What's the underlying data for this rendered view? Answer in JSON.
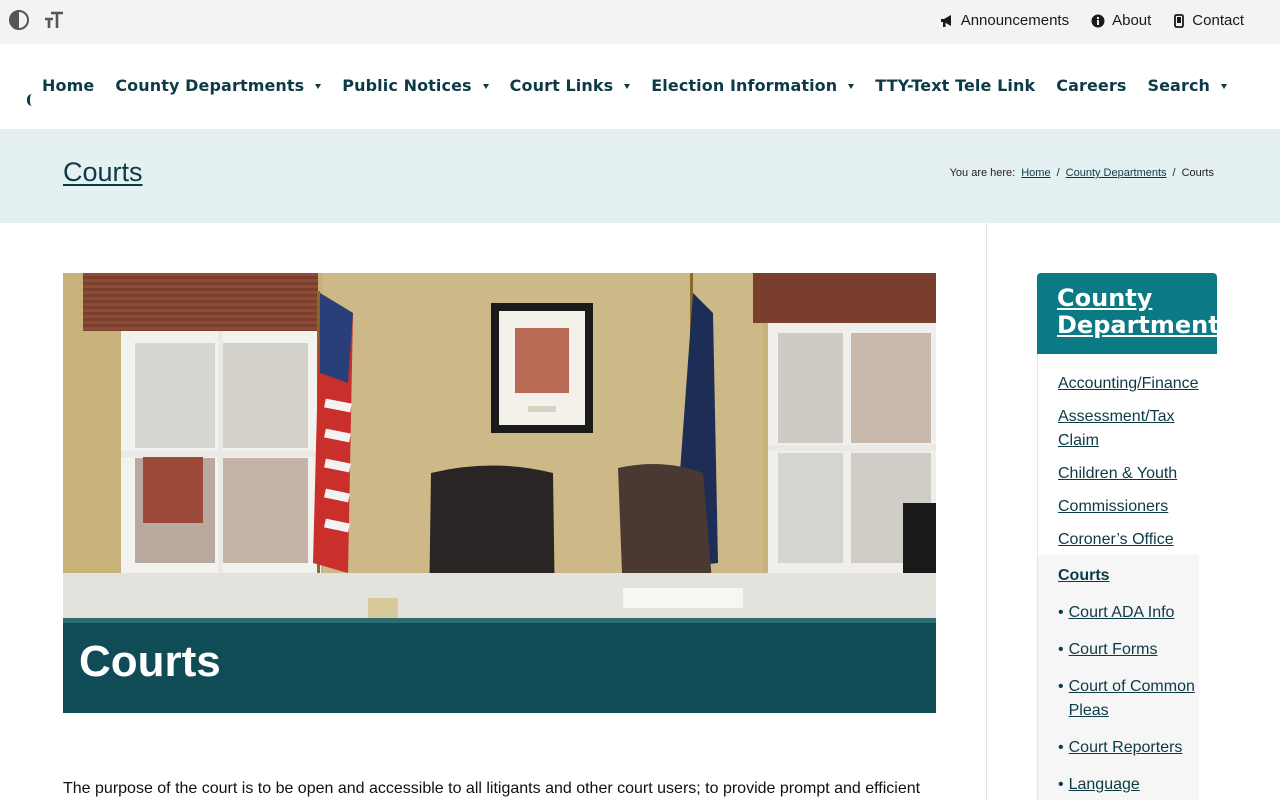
{
  "utility_bar": {
    "links": [
      {
        "label": "Announcements",
        "icon": "megaphone-icon"
      },
      {
        "label": "About",
        "icon": "info-icon"
      },
      {
        "label": "Contact",
        "icon": "phone-icon"
      }
    ],
    "tools": [
      "contrast-icon",
      "text-size-icon"
    ]
  },
  "nav": {
    "items": [
      {
        "label": "Home",
        "dropdown": false
      },
      {
        "label": "County Departments",
        "dropdown": true
      },
      {
        "label": "Public Notices",
        "dropdown": true
      },
      {
        "label": "Court Links",
        "dropdown": true
      },
      {
        "label": "Election Information",
        "dropdown": true
      },
      {
        "label": "TTY-Text Tele Link",
        "dropdown": false
      },
      {
        "label": "Careers",
        "dropdown": false
      },
      {
        "label": "Search",
        "dropdown": true
      }
    ]
  },
  "page_header": {
    "title": "Courts",
    "breadcrumb": {
      "prefix": "You are here:",
      "items": [
        "Home",
        "County Departments"
      ],
      "separator": "/",
      "current": "Courts"
    }
  },
  "hero": {
    "caption": "Courts"
  },
  "intro": {
    "text": "The purpose of the court is to be open and accessible to all litigants and other court users; to provide prompt and efficient"
  },
  "sidebar": {
    "title": "County Departments",
    "items": [
      "Accounting/Finance",
      "Assessment/Tax Claim",
      "Children & Youth",
      "Commissioners",
      "Coroner’s Office"
    ],
    "current": "Courts",
    "subitems": [
      "Court ADA Info",
      "Court Forms",
      "Court of Common Pleas",
      "Court Reporters",
      "Language"
    ]
  },
  "colors": {
    "brand_dark": "#0d3b45",
    "accent_teal": "#0c7a84",
    "header_band": "#e5f0f2",
    "topbar": "#f3f3f3"
  }
}
